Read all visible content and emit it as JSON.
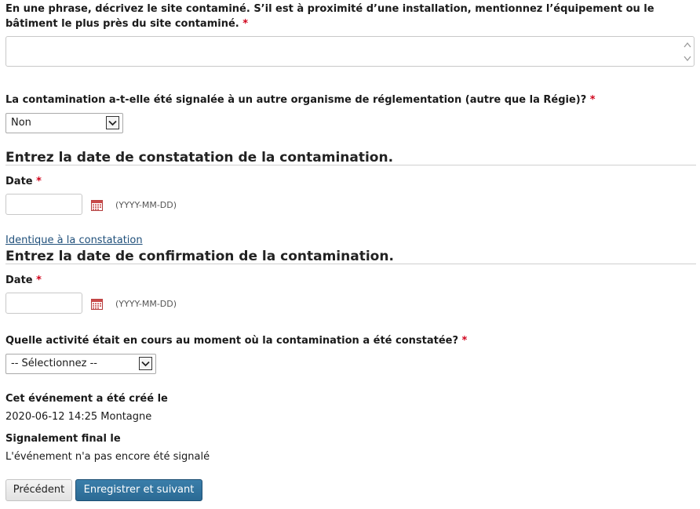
{
  "description": {
    "question": "En une phrase, décrivez le site contaminé. S’il est à proximité d’une installation, mentionnez l’équipement ou le bâtiment le plus près du site contaminé.",
    "required_mark": "*",
    "value": ""
  },
  "reported": {
    "question": "La contamination a-t-elle été signalée à un autre organisme de réglementation (autre que la Régie)?",
    "required_mark": "*",
    "selected": "Non"
  },
  "discovery_date": {
    "heading": "Entrez la date de constatation de la contamination.",
    "label": "Date",
    "required_mark": "*",
    "value": "",
    "format_hint": "(YYYY-MM-DD)"
  },
  "same_as_link": "Identique à la constatation",
  "confirmation_date": {
    "heading": "Entrez la date de confirmation de la contamination.",
    "label": "Date",
    "required_mark": "*",
    "value": "",
    "format_hint": "(YYYY-MM-DD)"
  },
  "activity": {
    "question": "Quelle activité était en cours au moment où la contamination a été constatée?",
    "required_mark": "*",
    "selected": "-- Sélectionnez --"
  },
  "created": {
    "label": "Cet événement a été créé le",
    "value": "2020-06-12 14:25 Montagne"
  },
  "final_report": {
    "label": "Signalement final le",
    "value": "L'événement n'a pas encore été signalé"
  },
  "buttons": {
    "previous": "Précédent",
    "save_next": "Enregistrer et suivant"
  },
  "icons": {
    "calendar": "calendar-icon",
    "dropdown": "chevron-down-icon"
  },
  "colors": {
    "required": "#d0021b",
    "primary_button": "#2f719c",
    "link": "#1f4f7a"
  }
}
